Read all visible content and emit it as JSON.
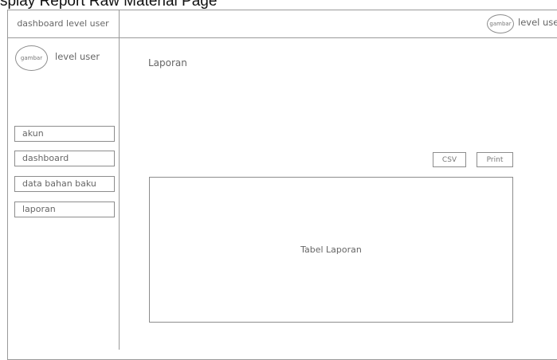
{
  "page_caption": "Display Report Raw Material Page",
  "header": {
    "dashboard_title": "dashboard level user",
    "avatar_label": "gambar",
    "user_label": "level user"
  },
  "sidebar": {
    "avatar_label": "gambar",
    "user_label": "level user",
    "items": [
      {
        "label": "akun"
      },
      {
        "label": "dashboard"
      },
      {
        "label": "data bahan baku"
      },
      {
        "label": "laporan"
      }
    ]
  },
  "main": {
    "title": "Laporan",
    "csv_label": "CSV",
    "print_label": "Print",
    "table_placeholder": "Tabel Laporan"
  }
}
